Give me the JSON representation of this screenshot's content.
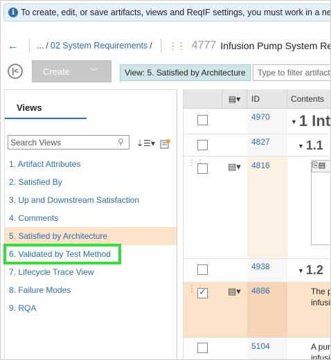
{
  "banner": {
    "text": "To create, edit, or save artifacts, views and ReqIF settings, you must work in a new"
  },
  "breadcrumb": {
    "ellipsis": "...",
    "link": "02 System Requirements",
    "slash": "/",
    "artifact_id": "4777",
    "artifact_title": "Infusion Pump System Req"
  },
  "toolbar": {
    "create_label": "Create",
    "current_view": "View: 5. Satisfied by Architecture",
    "filter_placeholder": "Type to filter artifacts"
  },
  "views_panel": {
    "tab_label": "Views",
    "search_placeholder": "Search Views",
    "items": [
      {
        "label": "1. Artifact Attributes"
      },
      {
        "label": "2. Satisfied By"
      },
      {
        "label": "3. Up and Downstream Satisfaction"
      },
      {
        "label": "4. Comments"
      },
      {
        "label": "5. Satisfied by Architecture"
      },
      {
        "label": "6. Validated by Test Method"
      },
      {
        "label": "7. Lifecycle Trace View"
      },
      {
        "label": "8. Failure Modes"
      },
      {
        "label": "9. RQA"
      }
    ],
    "selected_index": 4,
    "highlighted_index": 5
  },
  "grid": {
    "columns": {
      "id": "ID",
      "contents": "Contents"
    },
    "rows": [
      {
        "id": "4970",
        "content": "1  Int",
        "kind": "h1",
        "checked": false
      },
      {
        "id": "4827",
        "content": "1.1",
        "kind": "h2",
        "checked": false
      },
      {
        "id": "4816",
        "content": "",
        "kind": "image",
        "checked": false
      },
      {
        "id": "4938",
        "content": "1.2",
        "kind": "h2",
        "checked": false
      },
      {
        "id": "4886",
        "content": "The p",
        "content2": "infusi",
        "kind": "text",
        "checked": true
      },
      {
        "id": "5104",
        "content": "A pur",
        "content2": "infusi",
        "kind": "text",
        "checked": false
      }
    ]
  },
  "colors": {
    "accent": "#2e6db4",
    "selected_bg": "#fbe3c8",
    "highlight_outline": "#33e03a",
    "view_pill_bg": "#cfe6e6"
  }
}
